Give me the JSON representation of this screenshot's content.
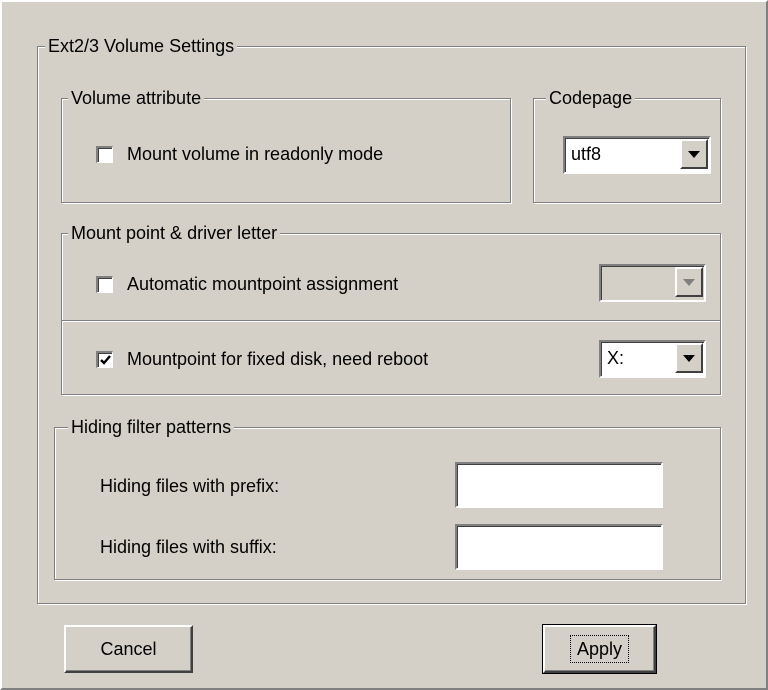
{
  "main_group": {
    "title": "Ext2/3 Volume Settings"
  },
  "volume_attribute": {
    "title": "Volume attribute",
    "readonly_label": "Mount volume in readonly mode",
    "readonly_checked": false
  },
  "codepage": {
    "title": "Codepage",
    "selected": "utf8"
  },
  "mount_point": {
    "title": "Mount point & driver letter",
    "auto_label": "Automatic mountpoint assignment",
    "auto_checked": false,
    "auto_drive_selected": "",
    "fixed_label": "Mountpoint for fixed disk, need reboot",
    "fixed_checked": true,
    "fixed_drive_selected": "X:"
  },
  "hiding": {
    "title": "Hiding filter patterns",
    "prefix_label": "Hiding files with prefix:",
    "prefix_value": "",
    "suffix_label": "Hiding files with suffix:",
    "suffix_value": ""
  },
  "buttons": {
    "cancel": "Cancel",
    "apply": "Apply"
  },
  "icons": {
    "checkmark": "checkmark-icon",
    "dropdown_arrow": "chevron-down-icon"
  },
  "colors": {
    "face": "#d4d0c8",
    "shadow": "#808080",
    "highlight": "#ffffff",
    "disabled_arrow": "#808080"
  }
}
